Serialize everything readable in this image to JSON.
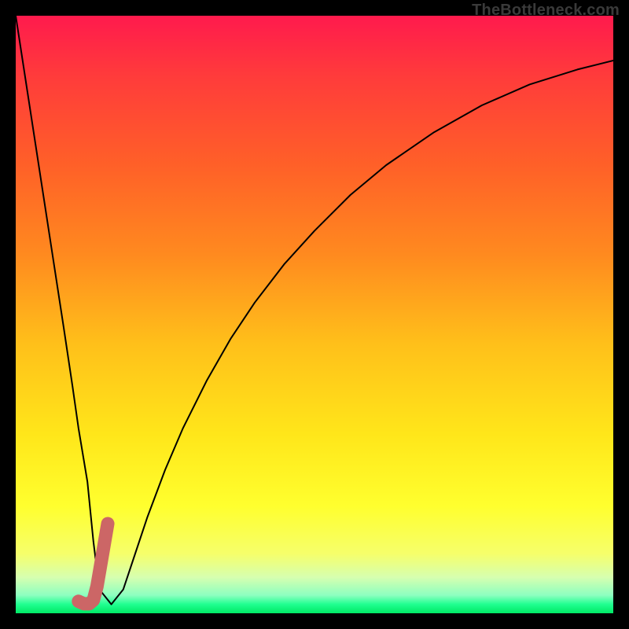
{
  "watermark": "TheBottleneck.com",
  "colors": {
    "frame": "#000000",
    "curve": "#000000",
    "highlight": "#cc6666",
    "gradient_top": "#ff1a4d",
    "gradient_bottom": "#00e865"
  },
  "chart_data": {
    "type": "line",
    "title": "",
    "xlabel": "",
    "ylabel": "",
    "xlim": [
      0,
      100
    ],
    "ylim": [
      0,
      100
    ],
    "grid": false,
    "legend": false,
    "series": [
      {
        "name": "v-curve",
        "x": [
          0,
          2,
          4,
          6,
          8,
          9.5,
          10.5,
          12,
          13,
          14,
          16,
          18,
          20,
          22,
          25,
          28,
          32,
          36,
          40,
          45,
          50,
          56,
          62,
          70,
          78,
          86,
          94,
          100
        ],
        "y": [
          100,
          87,
          74,
          61,
          48,
          38,
          31,
          22,
          12,
          4,
          1.5,
          4,
          10,
          16,
          24,
          31,
          39,
          46,
          52,
          58.5,
          64,
          70,
          75,
          80.5,
          85,
          88.5,
          91,
          92.5
        ]
      },
      {
        "name": "highlight",
        "x": [
          10.5,
          11.4,
          12.3,
          13.0,
          13.6,
          14.2,
          14.8,
          15.4
        ],
        "y": [
          2.0,
          1.6,
          1.6,
          2.2,
          4.5,
          8.0,
          11.5,
          15.0
        ]
      }
    ]
  }
}
